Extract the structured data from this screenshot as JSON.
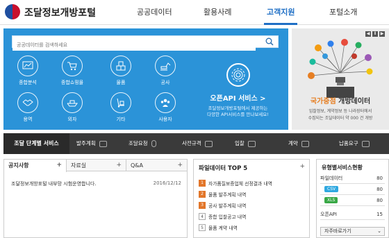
{
  "header": {
    "logo_text": "조달정보개방포털",
    "nav": [
      {
        "label": "공공데이터"
      },
      {
        "label": "활용사례"
      },
      {
        "label": "고객지원"
      },
      {
        "label": "포털소개"
      }
    ],
    "active_index": 2,
    "accent": "#1f6fc5"
  },
  "search": {
    "placeholder": "공공데이터를 검색하세요",
    "icon": "search-icon"
  },
  "categories": [
    {
      "label": "종합분석",
      "icon": "chart-icon"
    },
    {
      "label": "종합쇼핑몰",
      "icon": "cart-icon"
    },
    {
      "label": "물품",
      "icon": "boxes-icon"
    },
    {
      "label": "공사",
      "icon": "excavator-icon"
    },
    {
      "label": "용역",
      "icon": "handshake-icon"
    },
    {
      "label": "외자",
      "icon": "ship-icon"
    },
    {
      "label": "기타",
      "icon": "dolly-icon"
    },
    {
      "label": "사용자",
      "icon": "users-icon"
    }
  ],
  "api_service": {
    "title": "오픈API 서비스 >",
    "desc_line1": "조달정보개방포털에서 제공하는",
    "desc_line2": "다양한 API서비스를 만나보세요!",
    "icon": "api-fingerprint-icon"
  },
  "promo": {
    "pager": [
      "◀",
      "Ⅱ",
      "▶"
    ],
    "title_highlight": "국가중점",
    "title_rest": "개방데이터",
    "desc_line1": "입찰정보, 계약정보 등 나라장터에서",
    "desc_line2": "수집되는 조달데이터 약 000 건 개방",
    "accent": "#e67e22"
  },
  "service_bar": {
    "title": "조달 단계별 서비스",
    "items": [
      {
        "label": "발주계획",
        "icon": "calendar-icon"
      },
      {
        "label": "조달요청",
        "icon": "mouse-icon"
      },
      {
        "label": "사전규격",
        "icon": "ruler-icon"
      },
      {
        "label": "입찰",
        "icon": "megaphone-icon"
      },
      {
        "label": "계약",
        "icon": "handshake-icon"
      },
      {
        "label": "납품요구",
        "icon": "truck-icon"
      }
    ]
  },
  "notice": {
    "tabs": [
      "공지사항",
      "자료실",
      "Q&A"
    ],
    "plus": "+",
    "rows": [
      {
        "title": "조달정보개방포털 내부망 시험운영합니다.",
        "date": "2016/12/12"
      }
    ]
  },
  "top5": {
    "title": "파일데이터 TOP 5",
    "plus": "+",
    "items": [
      {
        "rank": "1",
        "title": "자가품질보증업체 선정결과 내역"
      },
      {
        "rank": "2",
        "title": "물품 발주계획 내역"
      },
      {
        "rank": "3",
        "title": "공사 발주계획 내역"
      },
      {
        "rank": "4",
        "title": "종합 입찰공고 내역"
      },
      {
        "rank": "5",
        "title": "물품 계약 내역"
      }
    ]
  },
  "stats": {
    "title": "유형별서비스현황",
    "rows": [
      {
        "label": "파일데이터",
        "value": "80"
      },
      {
        "label": "CSV",
        "value": "80",
        "color": "#2fa8e0"
      },
      {
        "label": "XLS",
        "value": "80",
        "color": "#39a846"
      },
      {
        "label": "오픈API",
        "value": "15"
      }
    ],
    "shortcut": "자주바로가기",
    "shortcut_chev": "⌄"
  }
}
